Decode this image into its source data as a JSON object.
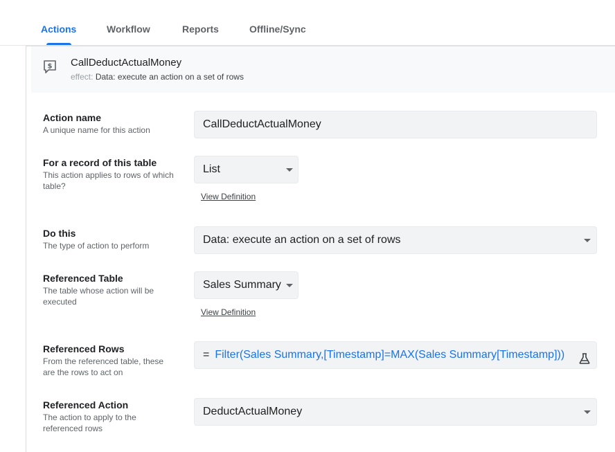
{
  "tabs": [
    {
      "label": "Actions",
      "active": true
    },
    {
      "label": "Workflow",
      "active": false
    },
    {
      "label": "Reports",
      "active": false
    },
    {
      "label": "Offline/Sync",
      "active": false
    }
  ],
  "header": {
    "icon": "dollar-chat-icon",
    "title": "CallDeductActualMoney",
    "effect_label": "effect:",
    "effect_value": "Data: execute an action on a set of rows"
  },
  "fields": {
    "action_name": {
      "label": "Action name",
      "help": "A unique name for this action",
      "value": "CallDeductActualMoney"
    },
    "for_record": {
      "label": "For a record of this table",
      "help": "This action applies to rows of which table?",
      "value": "List",
      "link": "View Definition"
    },
    "do_this": {
      "label": "Do this",
      "help": "The type of action to perform",
      "value": "Data: execute an action on a set of rows"
    },
    "referenced_table": {
      "label": "Referenced Table",
      "help": "The table whose action will be executed",
      "value": "Sales Summary",
      "link": "View Definition"
    },
    "referenced_rows": {
      "label": "Referenced Rows",
      "help": "From the referenced table, these are the rows to act on",
      "prefix": "=",
      "value": "Filter(Sales Summary,[Timestamp]=MAX(Sales Summary[Timestamp]))",
      "icon": "flask-icon"
    },
    "referenced_action": {
      "label": "Referenced Action",
      "help": "The action to apply to the referenced rows",
      "value": "DeductActualMoney"
    }
  },
  "colors": {
    "accent": "#1a73e8",
    "field_bg": "#f1f3f4",
    "header_bg": "#f8f9fa"
  }
}
